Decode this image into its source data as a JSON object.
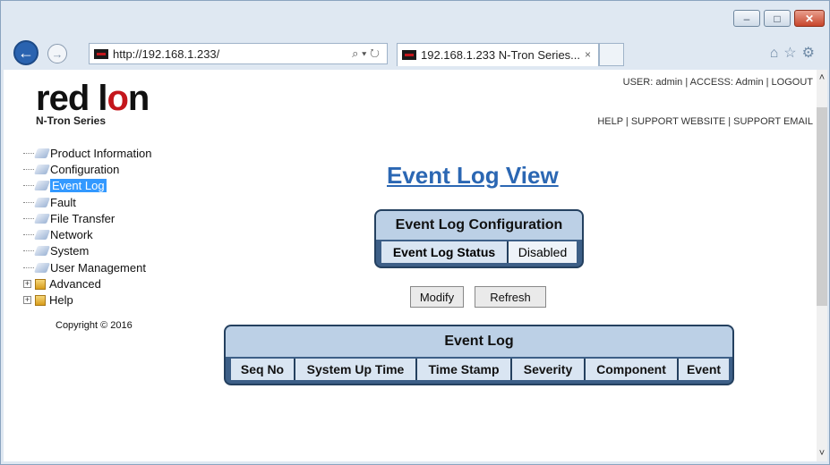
{
  "browser": {
    "address": "http://192.168.1.233/",
    "tab_title": "192.168.1.233 N-Tron Series...",
    "address_tools": "⌕ ▾ ↻",
    "tab_close": "×",
    "back_glyph": "←",
    "forward_glyph": "→",
    "minimize_glyph": "–",
    "maximize_glyph": "□",
    "close_glyph": "✕",
    "right_icons": "⌂☆⚙"
  },
  "header": {
    "logo_text_a": "red l",
    "logo_text_b": "o",
    "logo_text_c": "n",
    "logo_sub": "N-Tron Series",
    "user_line": "USER: admin  |  ACCESS: Admin  |  LOGOUT",
    "help_line": "HELP  |  SUPPORT WEBSITE  |  SUPPORT EMAIL"
  },
  "tree": {
    "items": [
      {
        "label": "Product Information"
      },
      {
        "label": "Configuration"
      },
      {
        "label": "Event Log"
      },
      {
        "label": "Fault"
      },
      {
        "label": "File Transfer"
      },
      {
        "label": "Network"
      },
      {
        "label": "System"
      },
      {
        "label": "User Management"
      }
    ],
    "folders": [
      {
        "label": "Advanced"
      },
      {
        "label": "Help"
      }
    ],
    "expand_glyph": "+",
    "copyright": "Copyright © 2016"
  },
  "main": {
    "heading": "Event Log View",
    "config": {
      "title": "Event Log Configuration",
      "status_label": "Event Log Status",
      "status_value": "Disabled"
    },
    "buttons": {
      "modify": "Modify",
      "refresh": "Refresh"
    },
    "log": {
      "title": "Event Log",
      "columns": [
        "Seq No",
        "System Up Time",
        "Time Stamp",
        "Severity",
        "Component",
        "Event"
      ]
    }
  },
  "scroll": {
    "up": "˄",
    "down": "˅"
  }
}
